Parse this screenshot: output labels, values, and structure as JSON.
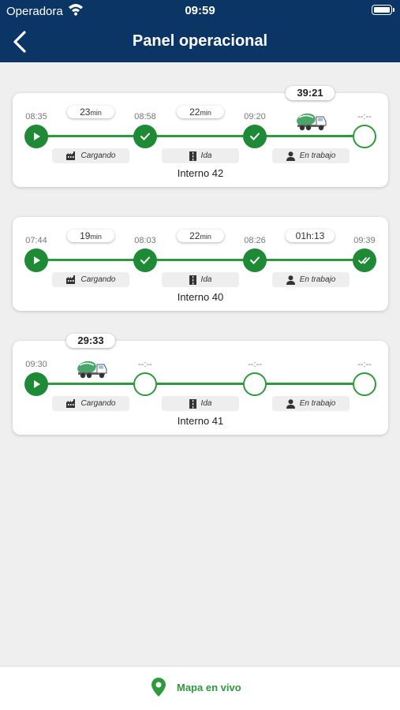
{
  "status_bar": {
    "carrier": "Operadora",
    "time": "09:59"
  },
  "header": {
    "title": "Panel operacional",
    "back_icon": "chevron-left-icon"
  },
  "colors": {
    "header": "#0b3564",
    "accent": "#2e9a3e",
    "node_done": "#1f8a35"
  },
  "stage_labels": [
    "Cargando",
    "Ida",
    "En trabajo"
  ],
  "stage_icons": [
    "factory-icon",
    "road-icon",
    "worker-icon"
  ],
  "cards": [
    {
      "interno": "Interno 42",
      "times": [
        "08:35",
        "08:58",
        "09:20",
        "--:--"
      ],
      "durations": [
        {
          "value": "23",
          "unit": "min"
        },
        {
          "value": "22",
          "unit": "min"
        }
      ],
      "timer": "39:21",
      "nodes": [
        "start",
        "done",
        "done",
        "pending"
      ]
    },
    {
      "interno": "Interno 40",
      "times": [
        "07:44",
        "08:03",
        "08:26",
        "09:39"
      ],
      "durations": [
        {
          "value": "19",
          "unit": "min"
        },
        {
          "value": "22",
          "unit": "min"
        },
        {
          "value": "01h:13",
          "unit": ""
        }
      ],
      "nodes": [
        "start",
        "done",
        "done",
        "done-double"
      ]
    },
    {
      "interno": "Interno 41",
      "times": [
        "09:30",
        "--:--",
        "--:--",
        "--:--"
      ],
      "timer": "29:33",
      "nodes": [
        "start",
        "pending",
        "pending",
        "pending"
      ]
    }
  ],
  "bottom": {
    "map_label": "Mapa en vivo",
    "map_icon": "map-pin-icon"
  }
}
